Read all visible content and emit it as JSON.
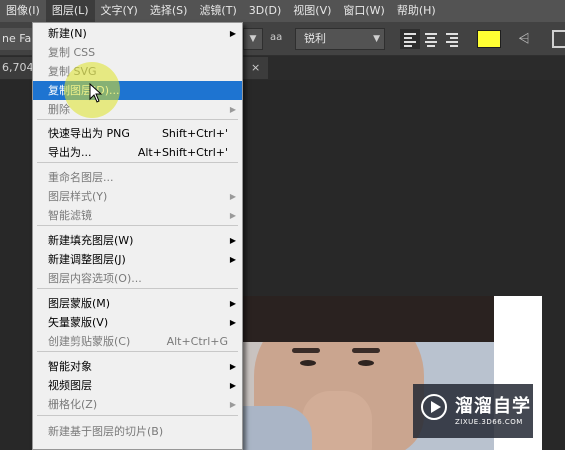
{
  "menubar": {
    "items": [
      "图像(I)",
      "图层(L)",
      "文字(Y)",
      "选择(S)",
      "滤镜(T)",
      "3D(D)",
      "视图(V)",
      "窗口(W)",
      "帮助(H)"
    ],
    "active_index": 1
  },
  "options_bar": {
    "font_name": "ne FanX",
    "aa_label": "aa",
    "antialias": "锐利",
    "text_color": "#ffff33"
  },
  "tabs": {
    "doc_tab": "6,704",
    "close_symbol": "×"
  },
  "menu": {
    "items": [
      {
        "label": "新建(N)",
        "shortcut": "",
        "submenu": true,
        "disabled": false
      },
      {
        "label": "复制 CSS",
        "shortcut": "",
        "submenu": false,
        "disabled": true
      },
      {
        "label": "复制 SVG",
        "shortcut": "",
        "submenu": false,
        "disabled": true
      },
      {
        "label": "复制图层(D)...",
        "shortcut": "",
        "submenu": false,
        "disabled": false,
        "highlight": true
      },
      {
        "label": "删除",
        "shortcut": "",
        "submenu": true,
        "disabled": true
      },
      {
        "label": "快速导出为 PNG",
        "shortcut": "Shift+Ctrl+'",
        "submenu": false,
        "disabled": false
      },
      {
        "label": "导出为...",
        "shortcut": "Alt+Shift+Ctrl+'",
        "submenu": false,
        "disabled": false
      },
      {
        "label": "重命名图层...",
        "shortcut": "",
        "submenu": false,
        "disabled": true
      },
      {
        "label": "图层样式(Y)",
        "shortcut": "",
        "submenu": true,
        "disabled": true
      },
      {
        "label": "智能滤镜",
        "shortcut": "",
        "submenu": true,
        "disabled": true
      },
      {
        "label": "新建填充图层(W)",
        "shortcut": "",
        "submenu": true,
        "disabled": false
      },
      {
        "label": "新建调整图层(J)",
        "shortcut": "",
        "submenu": true,
        "disabled": false
      },
      {
        "label": "图层内容选项(O)...",
        "shortcut": "",
        "submenu": false,
        "disabled": true
      },
      {
        "label": "图层蒙版(M)",
        "shortcut": "",
        "submenu": true,
        "disabled": false
      },
      {
        "label": "矢量蒙版(V)",
        "shortcut": "",
        "submenu": true,
        "disabled": false
      },
      {
        "label": "创建剪贴蒙版(C)",
        "shortcut": "Alt+Ctrl+G",
        "submenu": false,
        "disabled": true
      },
      {
        "label": "智能对象",
        "shortcut": "",
        "submenu": true,
        "disabled": false
      },
      {
        "label": "视频图层",
        "shortcut": "",
        "submenu": true,
        "disabled": false
      },
      {
        "label": "栅格化(Z)",
        "shortcut": "",
        "submenu": true,
        "disabled": true
      },
      {
        "label": "新建基于图层的切片(B)",
        "shortcut": "",
        "submenu": false,
        "disabled": true
      }
    ]
  },
  "watermark": {
    "title": "溜溜自学",
    "url": "ZIXUE.3D66.COM"
  }
}
